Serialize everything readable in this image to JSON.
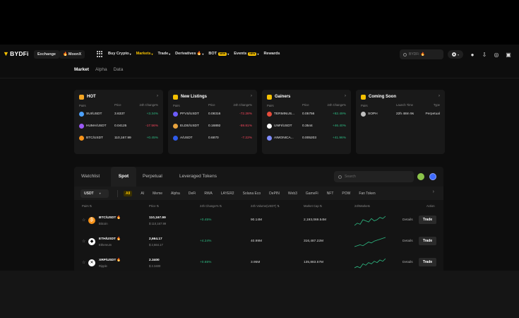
{
  "header": {
    "logo": "BYDFi",
    "exchange_label": "Exchange",
    "moonx_label": "MoonX",
    "nav": [
      {
        "label": "Buy Crypto",
        "caret": "▾",
        "active": false
      },
      {
        "label": "Markets",
        "caret": "▾",
        "active": true
      },
      {
        "label": "Trade",
        "caret": "▾",
        "active": false
      },
      {
        "label": "Derivatives",
        "caret": "▾",
        "active": false,
        "fire": true
      },
      {
        "label": "BOT",
        "caret": "▾",
        "active": false,
        "badge": "NEW"
      },
      {
        "label": "Events",
        "caret": "▾",
        "active": false,
        "badge": "NEW"
      },
      {
        "label": "Rewards",
        "caret": "",
        "active": false
      }
    ],
    "search_placeholder": "BYDFi"
  },
  "subnav": [
    "Market",
    "Alpha",
    "Data"
  ],
  "cards": [
    {
      "title": "HOT",
      "icon_color": "#f5a623",
      "headers": [
        "Pairs",
        "Price",
        "24h Change%"
      ],
      "rows": [
        {
          "pair": "SUI/USDT",
          "price": "3.6337",
          "change": "+3.34%",
          "dir": "pos",
          "coin_color": "#4da2ff"
        },
        {
          "pair": "HUMA/USDT",
          "price": "0.04125",
          "change": "-17.56%",
          "dir": "neg",
          "coin_color": "#9b59f5"
        },
        {
          "pair": "BTC/USDT",
          "price": "110,167.99",
          "change": "+0.45%",
          "dir": "pos",
          "coin_color": "#f7931a"
        }
      ]
    },
    {
      "title": "New Listings",
      "icon_color": "#f5c000",
      "headers": [
        "Pairs",
        "Price",
        "24h Change%"
      ],
      "rows": [
        {
          "pair": "PFVS/USDT",
          "price": "0.08316",
          "change": "-72.28%",
          "dir": "neg",
          "coin_color": "#6d5dfc"
        },
        {
          "pair": "ELDE/USDT",
          "price": "0.16892",
          "change": "-59.81%",
          "dir": "neg",
          "coin_color": "#e8a33d"
        },
        {
          "pair": "A/USDT",
          "price": "0.6870",
          "change": "-7.22%",
          "dir": "neg",
          "coin_color": "#2f5bea"
        }
      ]
    },
    {
      "title": "Gainers",
      "icon_color": "#f5c000",
      "headers": [
        "Pairs",
        "Price",
        "24h Change%"
      ],
      "rows": [
        {
          "pair": "TERMINUS...",
          "price": "0.05756",
          "change": "+82.49%",
          "dir": "pos",
          "coin_color": "#e74c3c"
        },
        {
          "pair": "UNFI/USDT",
          "price": "0.3544",
          "change": "+46.40%",
          "dir": "pos",
          "coin_color": "#ffffff"
        },
        {
          "pair": "AIMONICA...",
          "price": "0.005203",
          "change": "+41.96%",
          "dir": "pos",
          "coin_color": "#7f8cff"
        }
      ]
    },
    {
      "title": "Coming Soon",
      "icon_color": "#f5c000",
      "headers": [
        "Pairs",
        "Launch Time",
        "Type"
      ],
      "rows": [
        {
          "pair": "SOPH",
          "price": "22h 48m 9s",
          "change": "Perpetual",
          "dir": "",
          "coin_color": "#c0c0c0"
        }
      ]
    }
  ],
  "market_tabs": [
    "Watchlist",
    "Spot",
    "Perpetual",
    "Leveraged Tokens"
  ],
  "market_search_placeholder": "Search",
  "quote_select": "USDT",
  "filters": [
    "All",
    "AI",
    "Meme",
    "Alpha",
    "DeFi",
    "RWA",
    "LAYER2",
    "Solana Eco",
    "DePIN",
    "Web3",
    "GameFi",
    "NFT",
    "POW",
    "Fan Token"
  ],
  "table_headers": [
    "Pairs ⇅",
    "Price ⇅",
    "24h Change% ⇅",
    "24h Volume(USDT) ⇅",
    "Market Cap ⇅",
    "24hMarkets",
    "Action"
  ],
  "rows": [
    {
      "symbol": "BTC/USDT",
      "name": "Bitcoin",
      "price": "110,167.99",
      "price_sub": "$ 110,167.99",
      "change": "+0.45%",
      "volume": "90.14M",
      "cap": "2,193,069.54M",
      "coin_color": "#f7931a",
      "coin_glyph": "₿",
      "spark": [
        6,
        8,
        7,
        11,
        10,
        9,
        12,
        10,
        11,
        13,
        12,
        14
      ]
    },
    {
      "symbol": "ETH/USDT",
      "name": "Ethereum",
      "price": "2,664.17",
      "price_sub": "$ 2,664.17",
      "change": "+4.24%",
      "volume": "40.99M",
      "cap": "316,487.22M",
      "coin_color": "#ffffff",
      "coin_glyph": "◆",
      "spark": [
        4,
        5,
        6,
        5,
        7,
        9,
        8,
        10,
        11,
        12,
        13,
        14
      ]
    },
    {
      "symbol": "XRP/USDT",
      "name": "Ripple",
      "price": "2.3400",
      "price_sub": "$ 2.3400",
      "change": "+0.65%",
      "volume": "3.95M",
      "cap": "135,883.57M",
      "coin_color": "#ffffff",
      "coin_glyph": "✕",
      "spark": [
        6,
        7,
        6,
        9,
        8,
        10,
        9,
        11,
        10,
        12,
        11,
        13
      ]
    }
  ],
  "action_details": "Details",
  "action_trade": "Trade",
  "colors": {
    "accent": "#f5c000",
    "positive": "#2ebd85",
    "negative": "#f6465d"
  }
}
